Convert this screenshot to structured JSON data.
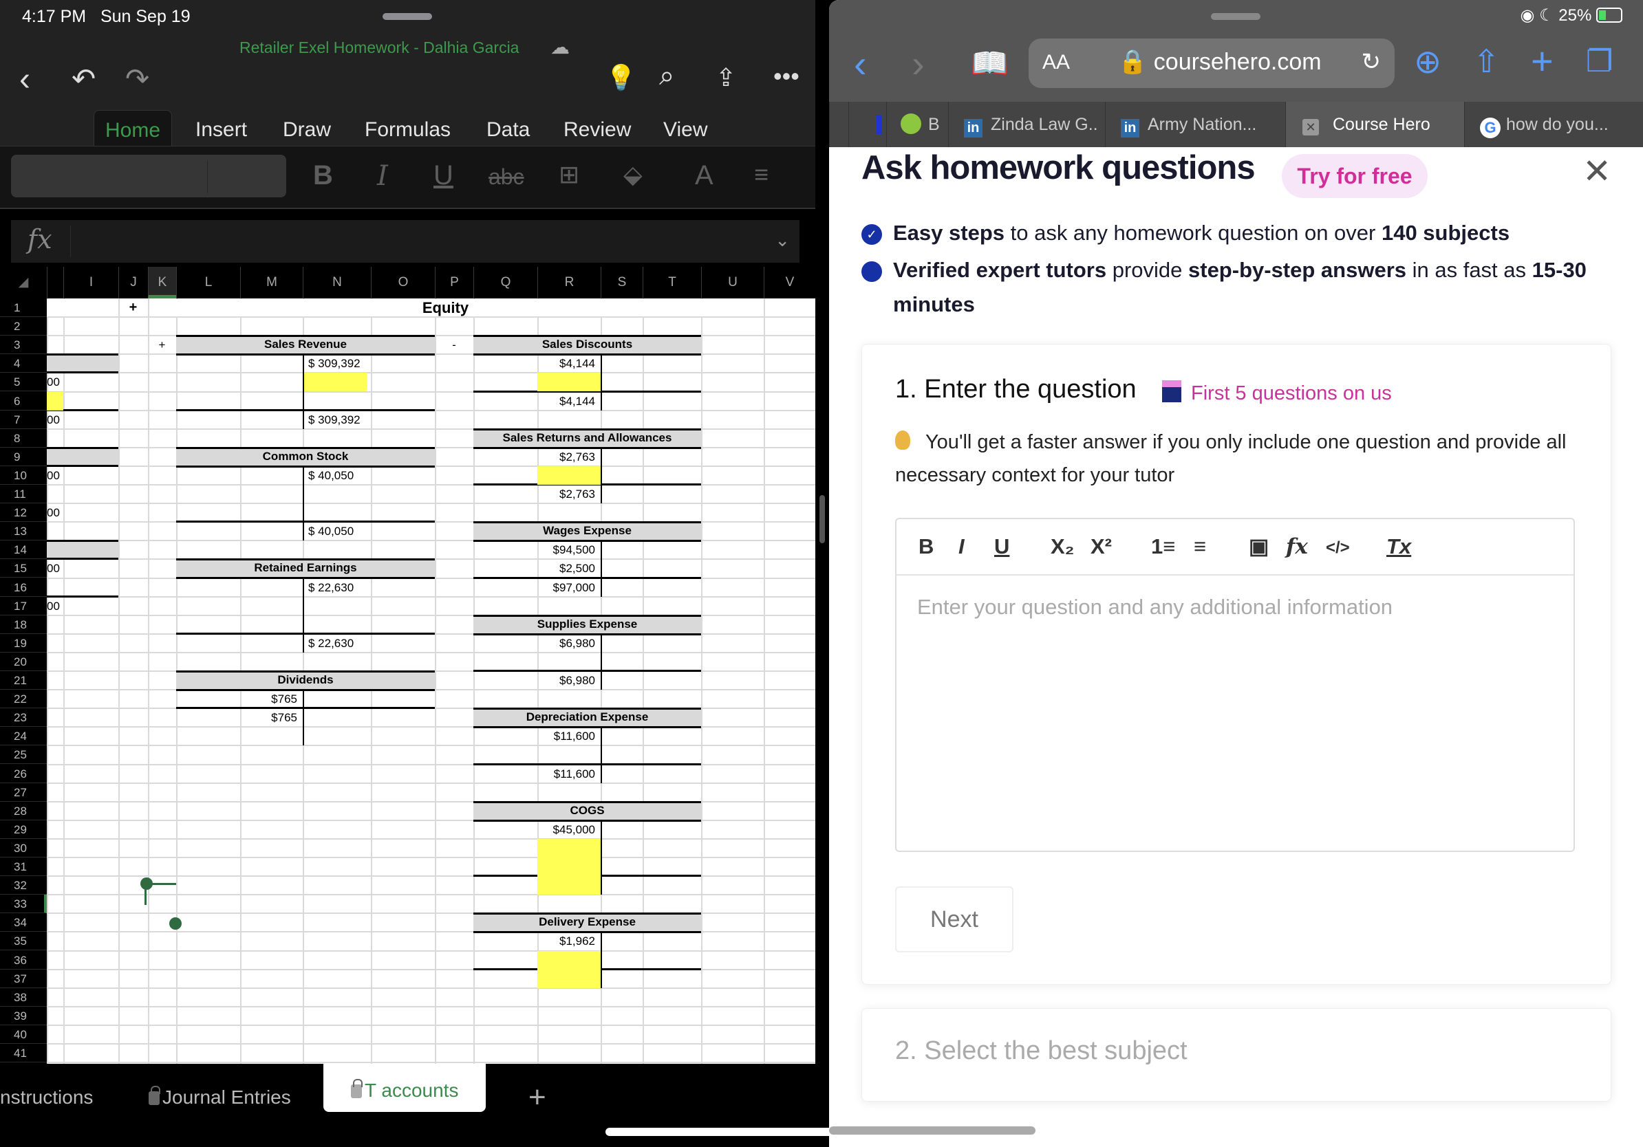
{
  "status_bar": {
    "time": "4:17 PM",
    "date": "Sun Sep 19",
    "battery": "25%"
  },
  "excel": {
    "doc_title": "Retailer Exel Homework - Dalhia Garcia",
    "toolbar_icons": [
      "back-icon",
      "undo-icon",
      "redo-icon",
      "lightbulb-icon",
      "search-icon",
      "share-icon",
      "more-icon"
    ],
    "ribbon_tabs": [
      "Home",
      "Insert",
      "Draw",
      "Formulas",
      "Data",
      "Review",
      "View"
    ],
    "active_tab": "Home",
    "ribbon_buttons": {
      "bold": "B",
      "italic": "I",
      "underline": "U",
      "strike": "abc",
      "font_color": "A"
    },
    "formula_label": "fx",
    "formula_value": "",
    "columns": [
      "I",
      "J",
      "K",
      "L",
      "M",
      "N",
      "O",
      "P",
      "Q",
      "R",
      "S",
      "T",
      "U",
      "V"
    ],
    "selected_column": "K",
    "rows": [
      "1",
      "2",
      "3",
      "4",
      "5",
      "6",
      "7",
      "8",
      "9",
      "10",
      "11",
      "12",
      "13",
      "14",
      "15",
      "16",
      "17",
      "18",
      "19",
      "20",
      "21",
      "22",
      "23",
      "24",
      "25",
      "26",
      "27",
      "28",
      "29",
      "30",
      "31",
      "32",
      "33",
      "34",
      "35",
      "36",
      "37",
      "38",
      "39",
      "40",
      "41"
    ],
    "selected_row": "33",
    "section_title": "Equity",
    "plus_sign_1": "+",
    "plus_sign_2": "+",
    "minus_sign": "-",
    "left_fragments": {
      "r5": "00",
      "r7": "00",
      "r10": "00",
      "r12": "00",
      "r15": "00",
      "r17": "00"
    },
    "accounts_left": [
      {
        "name": "Sales Revenue",
        "credit": [
          "$ 309,392"
        ],
        "credit_total": "$ 309,392"
      },
      {
        "name": "Common Stock",
        "credit": [
          "$  40,050"
        ],
        "credit_total": "$  40,050"
      },
      {
        "name": "Retained Earnings",
        "credit": [
          "$  22,630"
        ],
        "credit_total": "$  22,630"
      },
      {
        "name": "Dividends",
        "debit": [
          "$765"
        ],
        "debit_total": "$765"
      }
    ],
    "accounts_right": [
      {
        "name": "Sales Discounts",
        "debit": [
          "$4,144"
        ],
        "debit_total": "$4,144"
      },
      {
        "name": "Sales Returns and Allowances",
        "debit": [
          "$2,763"
        ],
        "debit_total": "$2,763"
      },
      {
        "name": "Wages Expense",
        "debit": [
          "$94,500",
          "$2,500"
        ],
        "debit_total": "$97,000"
      },
      {
        "name": "Supplies Expense",
        "debit": [
          "$6,980"
        ],
        "debit_total": "$6,980"
      },
      {
        "name": "Depreciation Expense",
        "debit": [
          "$11,600"
        ],
        "debit_total": "$11,600"
      },
      {
        "name": "COGS",
        "debit": [
          "$45,000"
        ],
        "debit_total": ""
      },
      {
        "name": "Delivery Expense",
        "debit": [
          "$1,962"
        ],
        "debit_total": ""
      }
    ],
    "sheet_tabs": [
      {
        "label": "nstructions",
        "locked": false
      },
      {
        "label": "Journal Entries",
        "locked": true
      },
      {
        "label": "T accounts",
        "locked": true,
        "active": true
      }
    ],
    "add_sheet": "+"
  },
  "safari": {
    "url": "coursehero.com",
    "aa_label": "AA",
    "tabs": [
      {
        "label": "",
        "icon": "favicon-1"
      },
      {
        "label": "",
        "icon": "favicon-2"
      },
      {
        "label": "B",
        "icon": "bartleby-icon"
      },
      {
        "label": "Zinda Law G..",
        "icon": "linkedin-icon"
      },
      {
        "label": "Army Nation...",
        "icon": "linkedin-icon"
      },
      {
        "label": "Course Hero",
        "icon": "close-tab-icon",
        "active": true
      },
      {
        "label": "how do you...",
        "icon": "google-icon"
      }
    ],
    "page": {
      "heading": "Ask homework questions",
      "try_badge": "Try for free",
      "bullets": [
        {
          "parts": [
            {
              "t": "Easy steps",
              "b": true
            },
            {
              "t": " to ask any homework question on over ",
              "b": false
            },
            {
              "t": "140 subjects",
              "b": true
            }
          ]
        },
        {
          "parts": [
            {
              "t": "Verified expert tutors",
              "b": true
            },
            {
              "t": " provide ",
              "b": false
            },
            {
              "t": "step-by-step answers",
              "b": true
            },
            {
              "t": " in as fast as ",
              "b": false
            },
            {
              "t": "15-30 minutes",
              "b": true
            }
          ]
        }
      ],
      "step1_title": "1. Enter the question",
      "step1_promo": "First 5 questions on us",
      "tip": "You'll get a faster answer if you only include one question and provide all necessary context for your tutor",
      "editor_tools": [
        "B",
        "I",
        "U",
        "X₂",
        "X²",
        "1≡",
        "≡",
        "▣",
        "fx",
        "</>",
        "Tx"
      ],
      "editor_placeholder": "Enter your question and any additional information",
      "next_button": "Next",
      "step2_title": "2. Select the best subject"
    }
  }
}
